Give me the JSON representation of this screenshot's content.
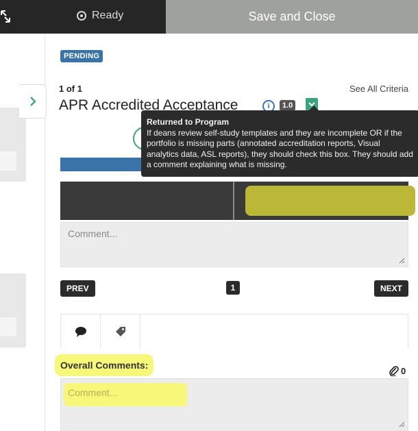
{
  "topbar": {
    "status_text": "Ready",
    "save_close_label": "Save and Close"
  },
  "criteria": {
    "status_badge": "PENDING",
    "count_text": "1 of 1",
    "see_all_label": "See All Criteria",
    "title": "APR Accredited Acceptance",
    "info_symbol": "i",
    "score": "1.0"
  },
  "tooltip": {
    "title": "Returned to Program",
    "body": "If deans review self-study templates and they are incomplete OR if the portfolio is missing parts (annotated accreditation reports, Visual analytics data, ASL reports), they should check this box. They should add a comment explaining what is missing."
  },
  "comment": {
    "placeholder": "Comment..."
  },
  "pagination": {
    "prev_label": "PREV",
    "page": "1",
    "next_label": "NEXT"
  },
  "tabs": [
    {
      "icon": "comment-bubble-icon"
    },
    {
      "icon": "tag-icon"
    }
  ],
  "overall": {
    "label": "Overall Comments:",
    "attachment_count": "0",
    "placeholder": "Comment..."
  },
  "colors": {
    "dark": "#262626",
    "save_bar": "#9ea29f",
    "pending_blue": "#3a73a8",
    "accent_green": "#3aa57a",
    "highlight_yellow": "#f7f77a"
  }
}
